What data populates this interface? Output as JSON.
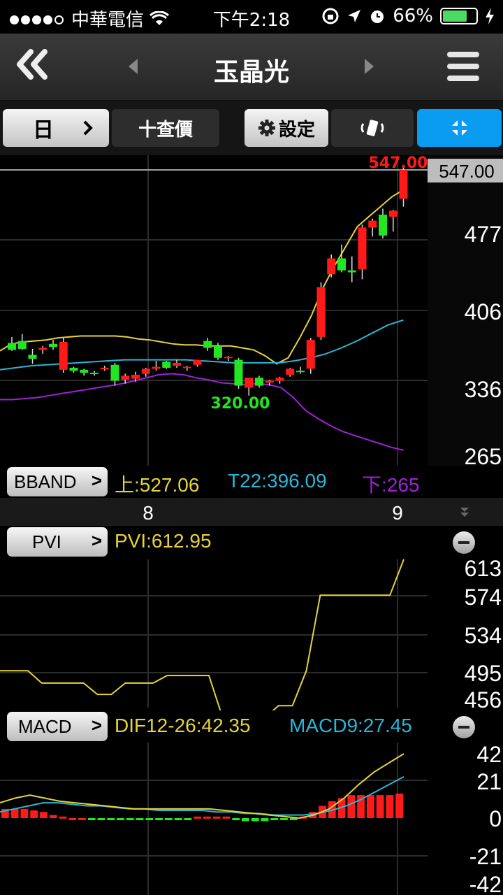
{
  "status_bar": {
    "carrier": "中華電信",
    "time": "下午2:18",
    "battery": "66%"
  },
  "nav": {
    "title": "玉晶光"
  },
  "toolbar": {
    "period_label": "日",
    "query_label": "十查價",
    "settings_label": "設定"
  },
  "colors": {
    "up": "#ff1a1a",
    "down": "#21e621",
    "upper_band": "#e6d33a",
    "mid_band": "#2ab6d6",
    "lower_band": "#a020d8",
    "pvi": "#e6d33a",
    "dif": "#e6d33a",
    "macd": "#2ab6d6",
    "accent": "#0a9cf0"
  },
  "price_panel": {
    "current_price": "547.00",
    "high_label": "547.00",
    "low_label": "320.00",
    "axis_labels": [
      "477",
      "406",
      "336",
      "265"
    ],
    "indicator_button": "BBAND",
    "upper_text": "上:527.06",
    "mid_text": "T22:396.09",
    "lower_text": "下:265"
  },
  "date_labels": [
    "8",
    "9"
  ],
  "pvi_panel": {
    "indicator_button": "PVI",
    "value_text": "PVI:612.95",
    "axis_labels": [
      "613",
      "574",
      "534",
      "495",
      "456"
    ]
  },
  "macd_panel": {
    "indicator_button": "MACD",
    "dif_text": "DIF12-26:42.35",
    "macd_text": "MACD9:27.45",
    "axis_labels": [
      "42",
      "21",
      "0",
      "-21",
      "-42"
    ]
  },
  "chart_data": {
    "type": "candlestick",
    "ylim": [
      265,
      547
    ],
    "candles": [
      {
        "o": 373,
        "h": 379,
        "l": 365,
        "c": 366
      },
      {
        "o": 375,
        "h": 382,
        "l": 366,
        "c": 367
      },
      {
        "o": 361,
        "h": 367,
        "l": 352,
        "c": 357
      },
      {
        "o": 366,
        "h": 370,
        "l": 362,
        "c": 368
      },
      {
        "o": 372,
        "h": 376,
        "l": 366,
        "c": 369
      },
      {
        "o": 346,
        "h": 378,
        "l": 343,
        "c": 374
      },
      {
        "o": 348,
        "h": 349,
        "l": 343,
        "c": 345
      },
      {
        "o": 346,
        "h": 347,
        "l": 340,
        "c": 343
      },
      {
        "o": 343,
        "h": 345,
        "l": 340,
        "c": 342
      },
      {
        "o": 347,
        "h": 350,
        "l": 345,
        "c": 348
      },
      {
        "o": 351,
        "h": 353,
        "l": 330,
        "c": 335
      },
      {
        "o": 336,
        "h": 342,
        "l": 332,
        "c": 340
      },
      {
        "o": 337,
        "h": 344,
        "l": 334,
        "c": 341
      },
      {
        "o": 342,
        "h": 348,
        "l": 339,
        "c": 347
      },
      {
        "o": 347,
        "h": 355,
        "l": 345,
        "c": 349
      },
      {
        "o": 354,
        "h": 355,
        "l": 347,
        "c": 348
      },
      {
        "o": 350,
        "h": 356,
        "l": 348,
        "c": 353
      },
      {
        "o": 348,
        "h": 350,
        "l": 345,
        "c": 349
      },
      {
        "o": 351,
        "h": 356,
        "l": 349,
        "c": 356
      },
      {
        "o": 375,
        "h": 378,
        "l": 365,
        "c": 368
      },
      {
        "o": 370,
        "h": 373,
        "l": 356,
        "c": 358
      },
      {
        "o": 358,
        "h": 360,
        "l": 355,
        "c": 359
      },
      {
        "o": 356,
        "h": 358,
        "l": 327,
        "c": 330
      },
      {
        "o": 328,
        "h": 338,
        "l": 320,
        "c": 338
      },
      {
        "o": 338,
        "h": 340,
        "l": 328,
        "c": 330
      },
      {
        "o": 333,
        "h": 336,
        "l": 330,
        "c": 335
      },
      {
        "o": 335,
        "h": 339,
        "l": 332,
        "c": 338
      },
      {
        "o": 341,
        "h": 348,
        "l": 339,
        "c": 347
      },
      {
        "o": 345,
        "h": 349,
        "l": 342,
        "c": 344
      },
      {
        "o": 347,
        "h": 378,
        "l": 342,
        "c": 376
      },
      {
        "o": 379,
        "h": 434,
        "l": 376,
        "c": 429
      },
      {
        "o": 442,
        "h": 462,
        "l": 439,
        "c": 458
      },
      {
        "o": 458,
        "h": 472,
        "l": 444,
        "c": 446
      },
      {
        "o": 446,
        "h": 460,
        "l": 434,
        "c": 444
      },
      {
        "o": 447,
        "h": 492,
        "l": 437,
        "c": 489
      },
      {
        "o": 489,
        "h": 498,
        "l": 480,
        "c": 496
      },
      {
        "o": 502,
        "h": 508,
        "l": 478,
        "c": 481
      },
      {
        "o": 500,
        "h": 507,
        "l": 485,
        "c": 506
      },
      {
        "o": 518,
        "h": 552,
        "l": 510,
        "c": 547
      }
    ],
    "bband_upper": [
      365,
      372,
      374,
      375,
      376,
      378,
      379,
      380,
      380,
      380,
      380,
      379,
      377,
      376,
      374,
      372,
      371,
      371,
      370,
      370,
      370,
      368,
      366,
      360,
      352,
      358,
      378,
      400,
      428,
      450,
      470,
      490,
      500,
      510,
      520,
      527
    ],
    "bband_mid": [
      346,
      348,
      350,
      351,
      352,
      353,
      354,
      355,
      356,
      356,
      356,
      356,
      356,
      355,
      354,
      353,
      353,
      353,
      353,
      355,
      358,
      362,
      368,
      375,
      383,
      391,
      396
    ],
    "bband_lower": [
      316,
      316,
      317,
      318,
      320,
      322,
      324,
      326,
      328,
      330,
      332,
      335,
      338,
      341,
      342,
      341,
      338,
      336,
      333,
      332,
      331,
      332,
      331,
      328,
      318,
      305,
      297,
      290,
      284,
      280,
      276,
      272,
      268,
      265
    ],
    "pvi": [
      495,
      495,
      495,
      482,
      482,
      482,
      482,
      470,
      470,
      482,
      482,
      482,
      490,
      490,
      490,
      490,
      445,
      445,
      445,
      445,
      458,
      458,
      495,
      575,
      575,
      575,
      575,
      575,
      575,
      613
    ],
    "macd_hist": [
      6,
      6,
      6,
      5,
      4,
      2,
      1,
      0,
      0,
      -1,
      -1,
      -1,
      -1,
      -1,
      -1,
      -1,
      -1,
      -1,
      -1,
      -1,
      1,
      1,
      1,
      1,
      -1,
      -2,
      -2,
      -2,
      -1,
      -1,
      -1,
      1,
      4,
      8,
      11,
      13,
      15,
      15,
      15,
      15,
      15,
      16
    ],
    "dif": [
      10,
      13,
      15,
      13,
      11,
      10,
      9,
      8,
      7,
      6,
      6,
      6,
      6,
      6,
      6,
      5,
      4,
      3,
      2,
      1,
      0,
      2,
      6,
      13,
      22,
      30,
      36,
      42
    ],
    "macd_line": [
      4,
      6,
      8,
      10,
      10,
      9,
      8,
      8,
      7,
      6,
      6,
      5,
      5,
      5,
      5,
      4,
      4,
      3,
      3,
      2,
      2,
      2,
      3,
      5,
      8,
      12,
      17,
      22,
      27
    ]
  }
}
